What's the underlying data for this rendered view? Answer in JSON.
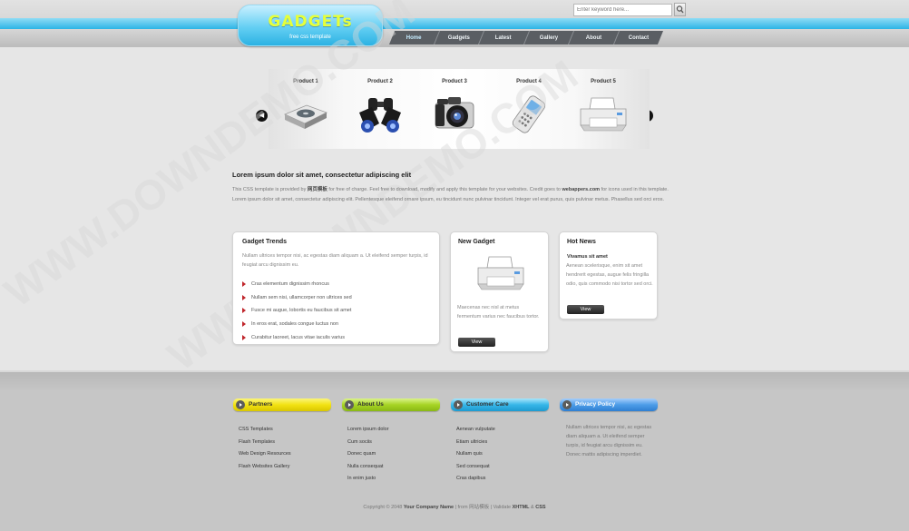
{
  "header": {
    "logo_title": "GADGETs",
    "logo_subtitle": "free css template",
    "search_placeholder": "Enter keyword here...",
    "nav": [
      "Home",
      "Gadgets",
      "Latest",
      "Gallery",
      "About",
      "Contact"
    ]
  },
  "slider": {
    "products": [
      {
        "label": "Product 1",
        "icon": "dvd-player-icon"
      },
      {
        "label": "Product 2",
        "icon": "binoculars-icon"
      },
      {
        "label": "Product 3",
        "icon": "camera-icon"
      },
      {
        "label": "Product 4",
        "icon": "mobile-phone-icon"
      },
      {
        "label": "Product 5",
        "icon": "printer-icon"
      }
    ],
    "prev": "◀",
    "next": "▶"
  },
  "intro": {
    "title": "Lorem ipsum dolor sit amet, consectetur adipiscing elit",
    "text_1": "This CSS template is provided by ",
    "text_bold_1": "网页模板",
    "text_2": " for free of charge. Feel free to download, modify and apply this template for your websites. Credit goes to ",
    "text_bold_2": "webappers.com",
    "text_3": " for icons used in this template. Lorem ipsum dolor sit amet, consectetur adipiscing elit. Pellentesque eleifend ornare ipsum, eu tincidunt nunc pulvinar tincidunt. Integer vel erat purus, quis pulvinar metus. Phasellus sed orci eros."
  },
  "trends": {
    "title": "Gadget Trends",
    "text": "Nullam ultrices tempor nisi, ac egestas diam aliquam a. Ut eleifend semper turpis, id feugiat arcu dignissim eu.",
    "items": [
      "Cras elementum dignissim rhoncus",
      "Nullam sem nisi, ullamcorper non ultrices sed",
      "Fusce mi augue, lobortis eu faucibus sit amet",
      "In eros erat, sodales congue luctus non",
      "Curabitur laoreet, lacus vitae iaculis varius"
    ]
  },
  "new_gadget": {
    "title": "New Gadget",
    "text": "Maecenas nec nisl at metus fermentum varius nec faucibus tortor.",
    "button": "View"
  },
  "hot_news": {
    "title": "Hot News",
    "headline": "Vivamus sit amet",
    "text": "Aenean scelerisque, enim sit amet hendrerit egestas, augue felis fringilla odio, quis commodo nisi tortor sed orci.",
    "button": "View"
  },
  "footer": {
    "partners": {
      "title": "Partners",
      "links": [
        "CSS Templates",
        "Flash Templates",
        "Web Design Resources",
        "Flash Websites Gallery"
      ]
    },
    "about": {
      "title": "About Us",
      "links": [
        "Lorem ipsum dolor",
        "Cum sociis",
        "Donec quam",
        "Nulla consequat",
        "In enim justo"
      ]
    },
    "customer_care": {
      "title": "Customer Care",
      "links": [
        "Aenean vulputate",
        "Etiam ultricies",
        "Nullam quis",
        "Sed consequat",
        "Cras dapibus"
      ]
    },
    "privacy": {
      "title": "Privacy Policy",
      "text": "Nullam ultrices tempor nisi, ac egestas diam aliquam a. Ut eleifend semper turpis, id feugiat arcu dignissim eu. Donec mattis adipiscing imperdiet."
    },
    "copyright": {
      "prefix": "Copyright © 2048 ",
      "company": "Your Company Name",
      "from": " | from ",
      "source": "网站模板",
      "validate": " | Validate ",
      "xhtml": "XHTML",
      "amp": " & ",
      "css": "CSS"
    }
  },
  "watermark": "WWW.DOWNDEMO.COM",
  "colors": {
    "cyan": "#2cb4e6",
    "yellow_pill": "#f2e212",
    "green_pill": "#a6d424",
    "blue_pill": "#36b6e8",
    "blue2_pill": "#4c9ce8",
    "bullet": "#c0262c"
  }
}
